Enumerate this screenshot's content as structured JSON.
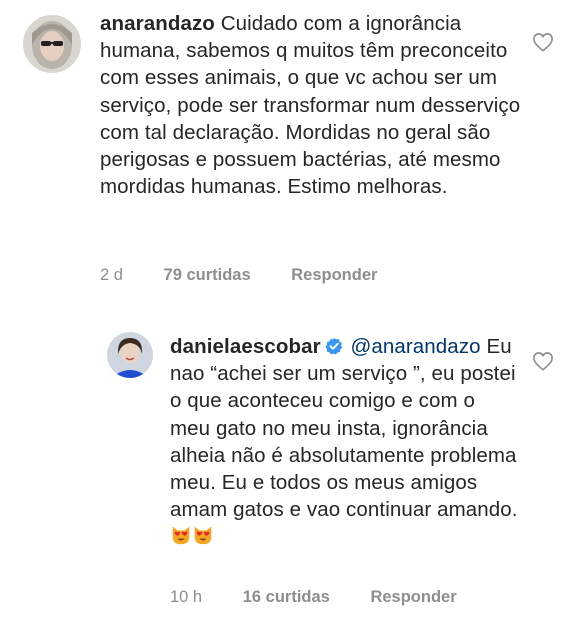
{
  "comments": [
    {
      "username": "anarandazo",
      "text": "Cuidado com a ignorância humana, sabemos q muitos têm preconceito com esses animais, o que vc achou ser um serviço, pode ser transformar num desserviço com tal declaração. Mordidas no geral são perigosas e possuem bactérias, até mesmo mordidas humanas. Estimo melhoras.",
      "time": "2 d",
      "likes": "79 curtidas",
      "reply_label": "Responder"
    },
    {
      "username": "danielaescobar",
      "mention": "@anarandazo",
      "text": "Eu nao “achei ser um serviço ”, eu postei o que aconteceu comigo e com o meu gato no meu insta, ignorância alheia não é absolutamente problema meu. Eu e todos os meus amigos amam gatos e vao continuar amando.",
      "emojis": [
        "heart-eyes-cat-emoji",
        "heart-eyes-cat-emoji"
      ],
      "time": "10 h",
      "likes": "16 curtidas",
      "reply_label": "Responder"
    }
  ],
  "colors": {
    "text": "#262626",
    "meta": "#8e8e8e",
    "mention": "#00376b",
    "verified": "#3897f0"
  }
}
